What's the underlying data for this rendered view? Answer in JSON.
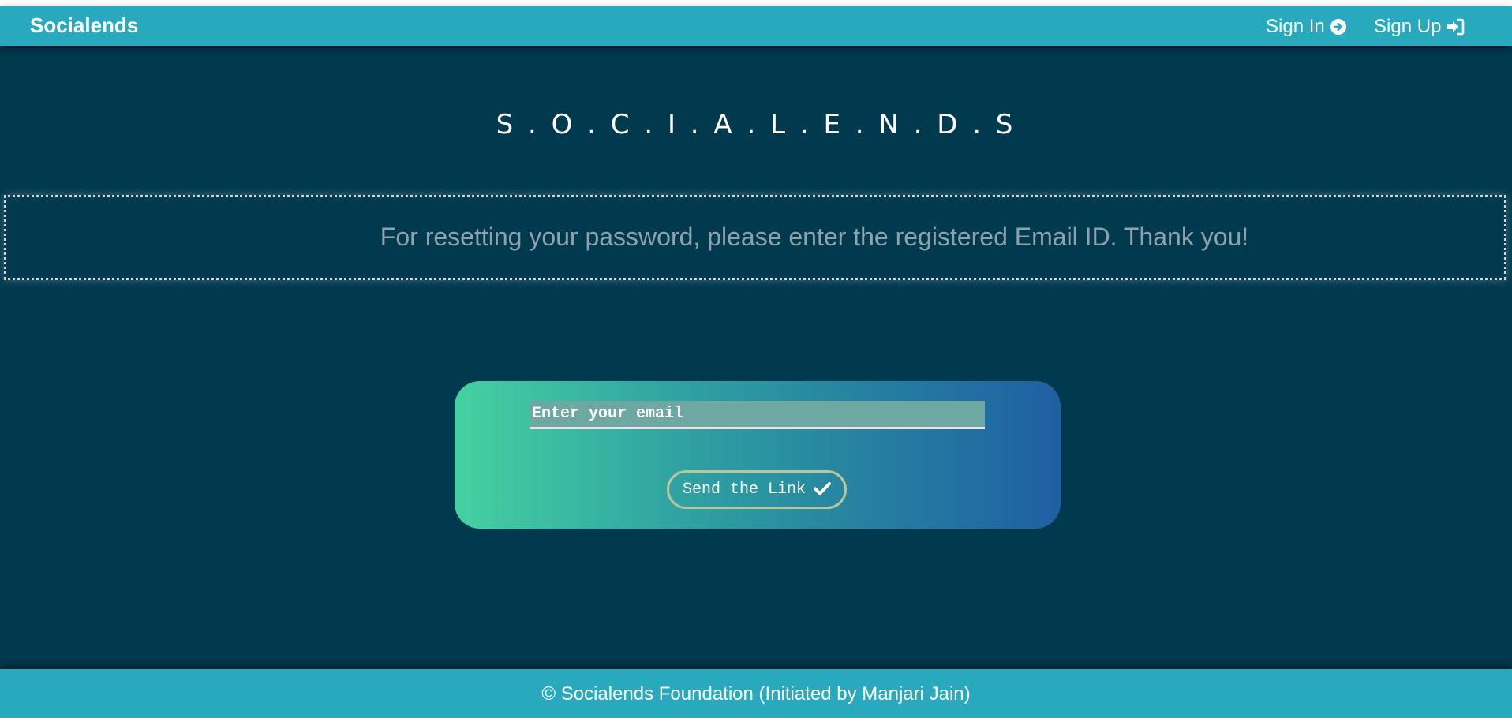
{
  "navbar": {
    "brand": "Socialends",
    "sign_in_label": "Sign In",
    "sign_in_icon": "arrow-circle-right-icon",
    "sign_up_label": "Sign Up",
    "sign_up_icon": "sign-in-icon"
  },
  "main": {
    "title": "S . O . C . I . A . L . E . N . D . S",
    "notice": "For resetting your password, please enter the registered Email ID. Thank you!"
  },
  "reset_form": {
    "email_placeholder": "Enter your email",
    "email_value": "",
    "send_label": "Send the Link",
    "send_icon": "check-icon"
  },
  "footer": {
    "text": "© Socialends Foundation (Initiated by Manjari Jain)"
  },
  "colors": {
    "navbar_bg": "#29a9be",
    "page_bg": "#01394f",
    "card_gradient_start": "#45d1a1",
    "card_gradient_end": "#1f5fa3",
    "notice_text": "#8ca3ad"
  }
}
